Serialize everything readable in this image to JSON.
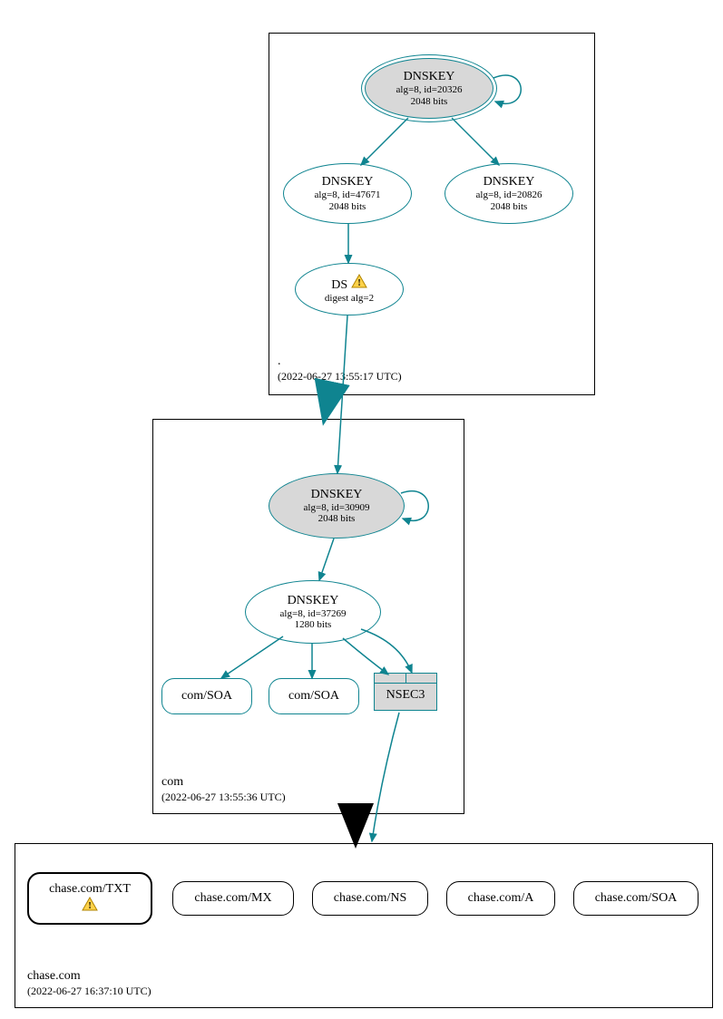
{
  "colors": {
    "teal": "#0f8490",
    "black": "#000000",
    "gray_fill": "#d8d8d8"
  },
  "zones": {
    "root": {
      "name": ".",
      "timestamp": "(2022-06-27 13:55:17 UTC)"
    },
    "com": {
      "name": "com",
      "timestamp": "(2022-06-27 13:55:36 UTC)"
    },
    "chase": {
      "name": "chase.com",
      "timestamp": "(2022-06-27 16:37:10 UTC)"
    }
  },
  "nodes": {
    "root_ksk": {
      "title": "DNSKEY",
      "line1": "alg=8, id=20326",
      "line2": "2048 bits"
    },
    "root_zsk1": {
      "title": "DNSKEY",
      "line1": "alg=8, id=47671",
      "line2": "2048 bits"
    },
    "root_zsk2": {
      "title": "DNSKEY",
      "line1": "alg=8, id=20826",
      "line2": "2048 bits"
    },
    "root_ds": {
      "title": "DS",
      "line1": "digest alg=2"
    },
    "com_ksk": {
      "title": "DNSKEY",
      "line1": "alg=8, id=30909",
      "line2": "2048 bits"
    },
    "com_zsk": {
      "title": "DNSKEY",
      "line1": "alg=8, id=37269",
      "line2": "1280 bits"
    },
    "com_soa1": {
      "title": "com/SOA"
    },
    "com_soa2": {
      "title": "com/SOA"
    },
    "nsec3": {
      "title": "NSEC3"
    },
    "chase_txt": {
      "title": "chase.com/TXT"
    },
    "chase_mx": {
      "title": "chase.com/MX"
    },
    "chase_ns": {
      "title": "chase.com/NS"
    },
    "chase_a": {
      "title": "chase.com/A"
    },
    "chase_soa": {
      "title": "chase.com/SOA"
    }
  }
}
